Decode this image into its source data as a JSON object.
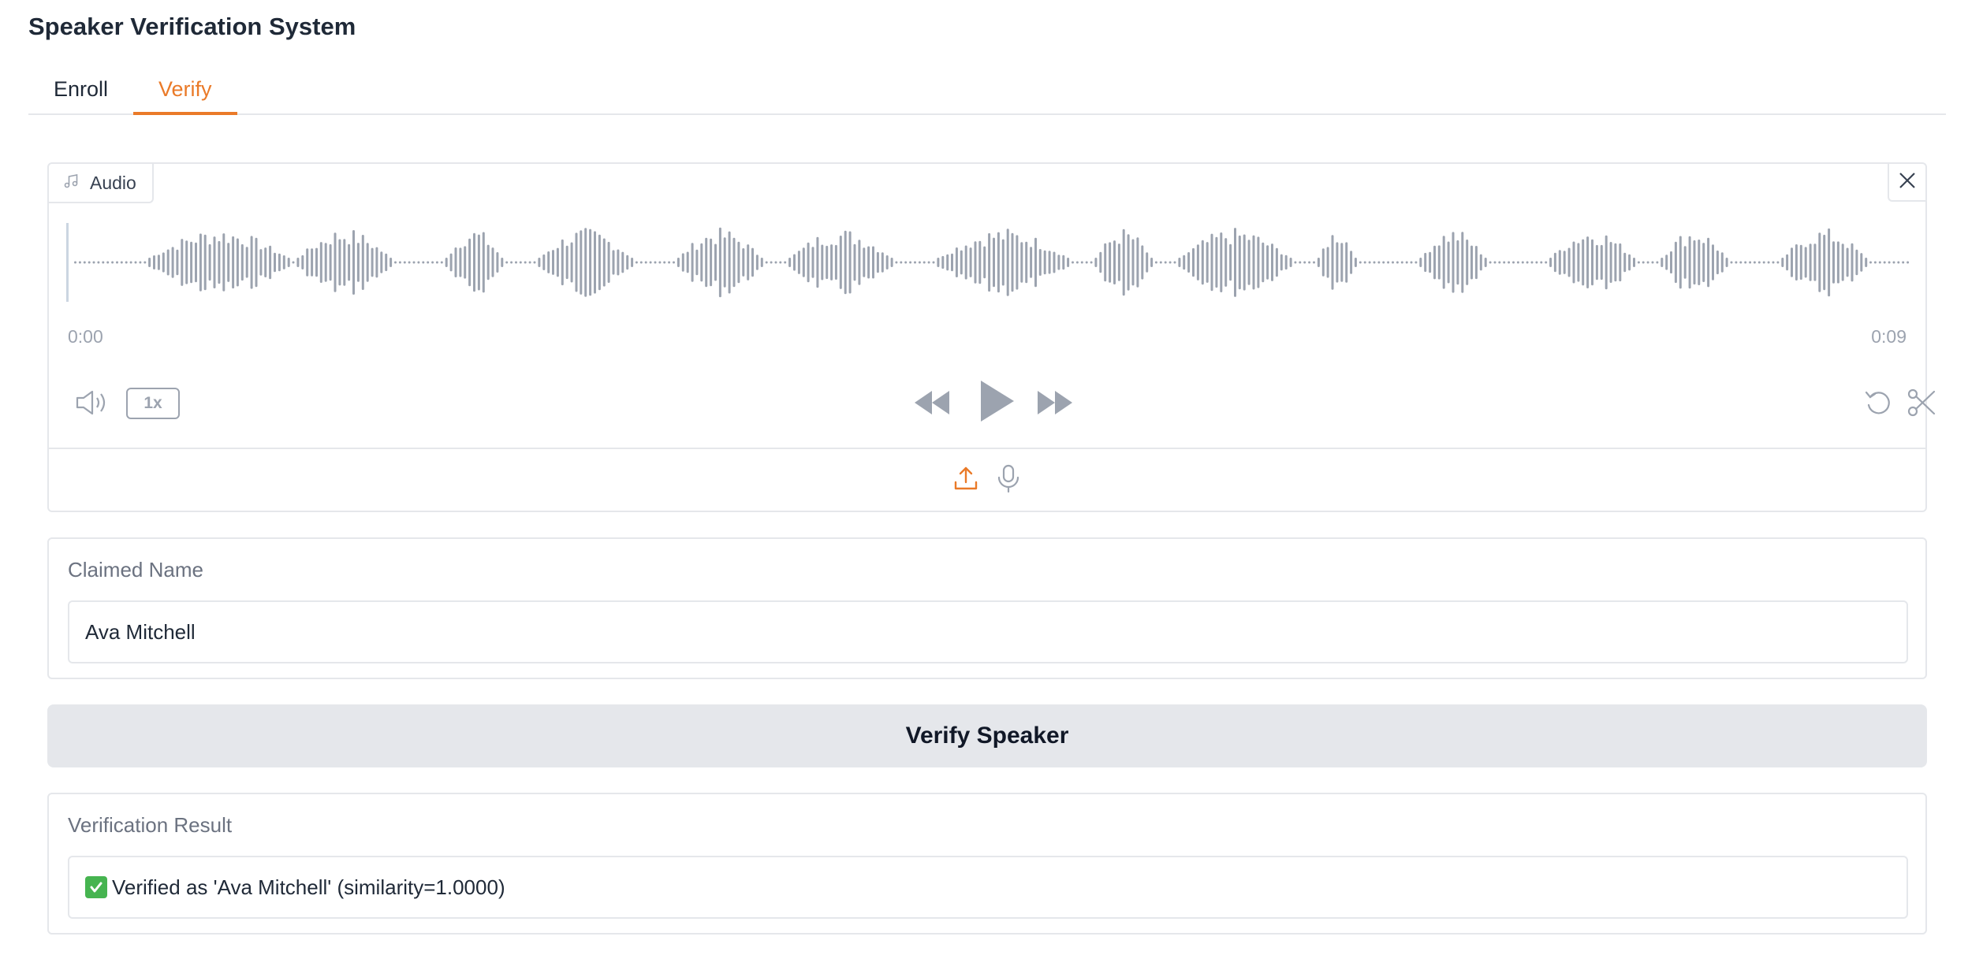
{
  "app": {
    "title": "Speaker Verification System"
  },
  "tabs": [
    {
      "label": "Enroll",
      "active": false
    },
    {
      "label": "Verify",
      "active": true
    }
  ],
  "audio": {
    "label": "Audio",
    "time_start": "0:00",
    "time_end": "0:09",
    "speed": "1x",
    "icons": {
      "label": "music-note-icon",
      "close": "close-icon",
      "volume": "volume-icon",
      "rewind": "rewind-icon",
      "play": "play-icon",
      "forward": "fast-forward-icon",
      "reset": "undo-icon",
      "trim": "scissors-icon",
      "upload": "upload-icon",
      "mic": "microphone-icon"
    }
  },
  "claimed_name": {
    "label": "Claimed Name",
    "value": "Ava Mitchell"
  },
  "verify_button": {
    "label": "Verify Speaker"
  },
  "result": {
    "label": "Verification Result",
    "value": "Verified as 'Ava Mitchell' (similarity=1.0000)"
  },
  "colors": {
    "accent": "#ea7a28",
    "waveform": "#9ca3af",
    "success": "#46b450"
  }
}
